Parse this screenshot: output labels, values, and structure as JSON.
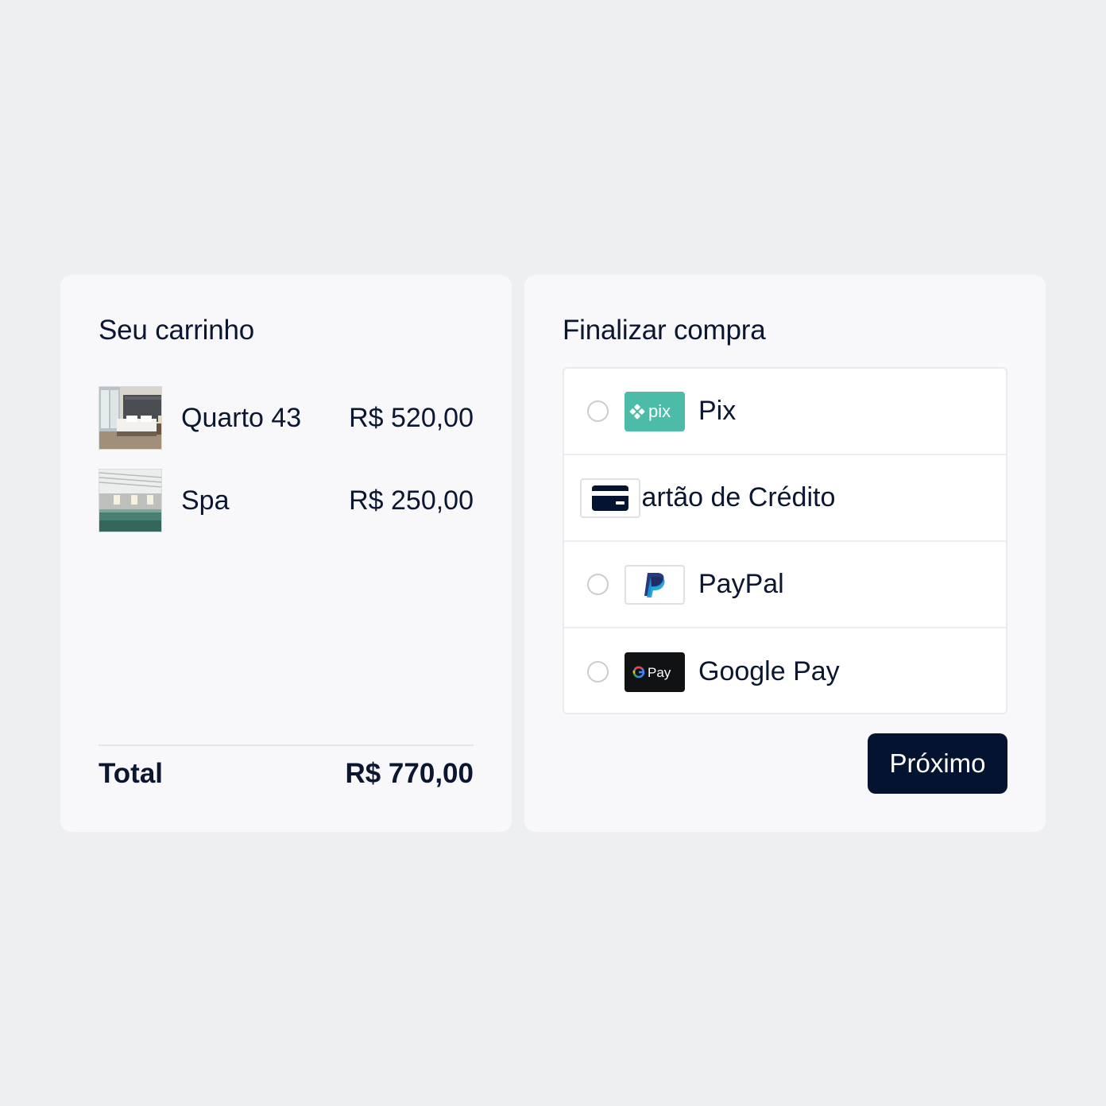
{
  "cart": {
    "title": "Seu carrinho",
    "items": [
      {
        "name": "Quarto 43",
        "price": "R$ 520,00",
        "image": "hotel-room-photo"
      },
      {
        "name": "Spa",
        "price": "R$ 250,00",
        "image": "spa-pool-photo"
      }
    ],
    "total_label": "Total",
    "total_value": "R$ 770,00"
  },
  "checkout": {
    "title": "Finalizar compra",
    "methods": [
      {
        "label": "Pix",
        "icon": "pix-icon",
        "logo_text": "pix",
        "selected": false
      },
      {
        "label": "Cartão de Crédito",
        "icon": "credit-card-icon",
        "selected": false
      },
      {
        "label": "PayPal",
        "icon": "paypal-icon",
        "selected": false
      },
      {
        "label": "Google Pay",
        "icon": "google-pay-icon",
        "logo_text": "Pay",
        "selected": false
      }
    ],
    "next_label": "Próximo"
  },
  "colors": {
    "background": "#eeeff1",
    "card": "#f8f8fb",
    "text": "#0b1730",
    "button": "#04132f",
    "pix": "#4cbba8"
  }
}
